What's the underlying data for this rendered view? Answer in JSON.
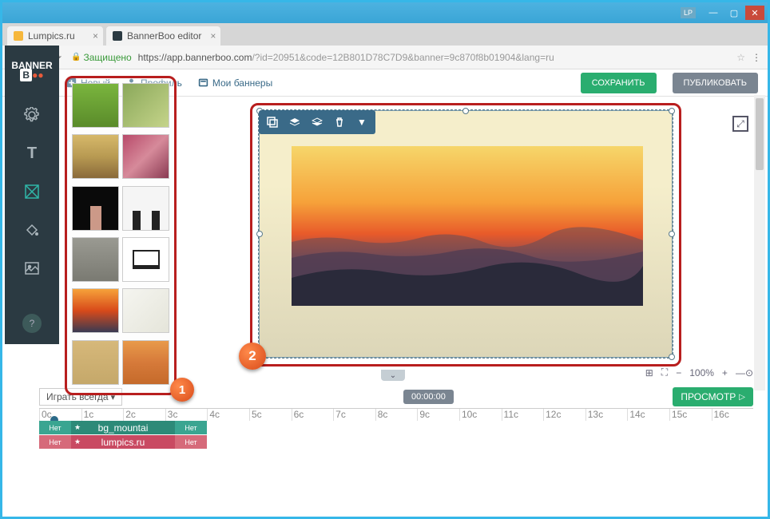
{
  "window": {
    "lp": "LP"
  },
  "tabs": [
    {
      "title": "Lumpics.ru"
    },
    {
      "title": "BannerBoo editor"
    }
  ],
  "address": {
    "secure": "Защищено",
    "host": "https://app.bannerboo.com",
    "path": "/?id=20951&code=12B801D78C7D9&banner=9c870f8b01904&lang=ru"
  },
  "appmenu": {
    "new": "Новый",
    "profile": "Профиль",
    "mybanners": "Мои баннеры",
    "save": "СОХРАНИТЬ",
    "publish": "ПУБЛИКОВАТЬ"
  },
  "logo": "BANNER BOO",
  "thumbs": [
    {
      "bg": "linear-gradient(#7ab53e,#5a8b2a)"
    },
    {
      "bg": "linear-gradient(135deg,#8aa85a,#c5d48a)"
    },
    {
      "bg": "linear-gradient(#d6b86a,#b89a52,#8a6a3a)"
    },
    {
      "bg": "linear-gradient(135deg,#b84a6a,#d68a9a,#8a3a52)"
    },
    {
      "bg": "#0a0a0a"
    },
    {
      "bg": "#f5f5f5"
    },
    {
      "bg": "linear-gradient(#9a9a92,#7a7a72)"
    },
    {
      "bg": "#ffffff"
    },
    {
      "bg": "linear-gradient(#f6a23a,#d84a1a 50%,#3a3a52)"
    },
    {
      "bg": "linear-gradient(135deg,#f5f5f0,#e5e5da)"
    },
    {
      "bg": "linear-gradient(#d6b87a,#c5a86a)"
    },
    {
      "bg": "linear-gradient(#e89a4a,#d67a3a,#c56a2a)"
    }
  ],
  "zoom": {
    "pct": "100%"
  },
  "timeline": {
    "play_mode": "Играть всегда",
    "time": "00:00:00",
    "preview": "ПРОСМОТР",
    "ticks": [
      "0c",
      "1c",
      "2c",
      "3c",
      "4c",
      "5c",
      "6c",
      "7c",
      "8c",
      "9c",
      "10c",
      "11c",
      "12c",
      "13c",
      "14c",
      "15c",
      "16c"
    ],
    "track1": {
      "a": "Нет",
      "b": "bg_mountai",
      "c": "Нет"
    },
    "track2": {
      "a": "Нет",
      "b": "lumpics.ru",
      "c": "Нет"
    }
  },
  "markers": {
    "m1": "1",
    "m2": "2"
  }
}
